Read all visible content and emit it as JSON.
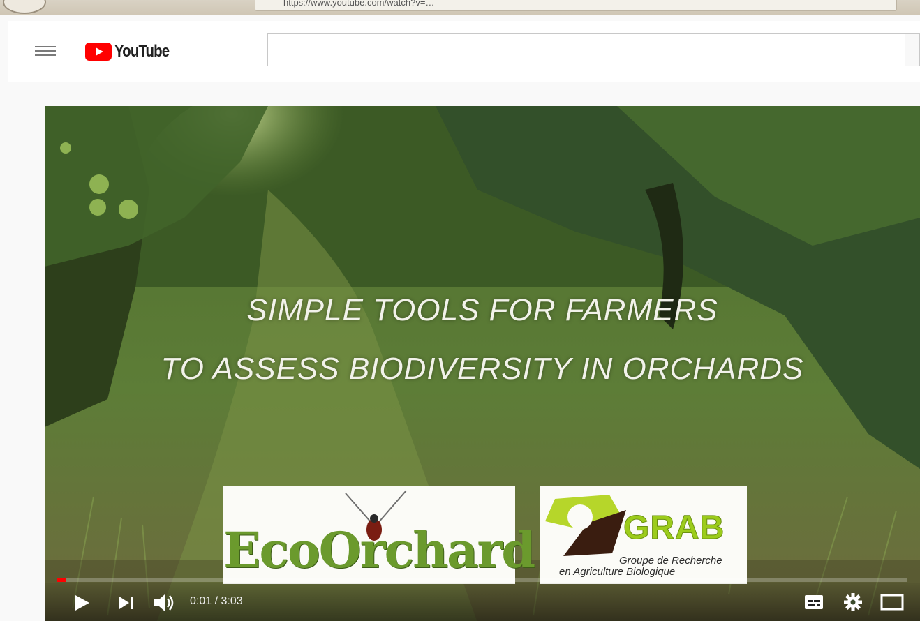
{
  "browser": {
    "address_text": "https://www.youtube.com/watch?v=…"
  },
  "masthead": {
    "logo_text": "YouTube",
    "search_value": ""
  },
  "player": {
    "title_line_1": "SIMPLE TOOLS FOR FARMERS",
    "title_line_2": "TO ASSESS BIODIVERSITY IN ORCHARDS",
    "logos": {
      "ecoorchard": "EcoOrchard",
      "grab": "GRAB",
      "grab_subtitle_1": "Groupe de Recherche",
      "grab_subtitle_2": "en Agriculture Biologique"
    },
    "time_display": "0:01 / 3:03",
    "progress_fraction": 0.011,
    "progress_color": "#ff0000"
  }
}
